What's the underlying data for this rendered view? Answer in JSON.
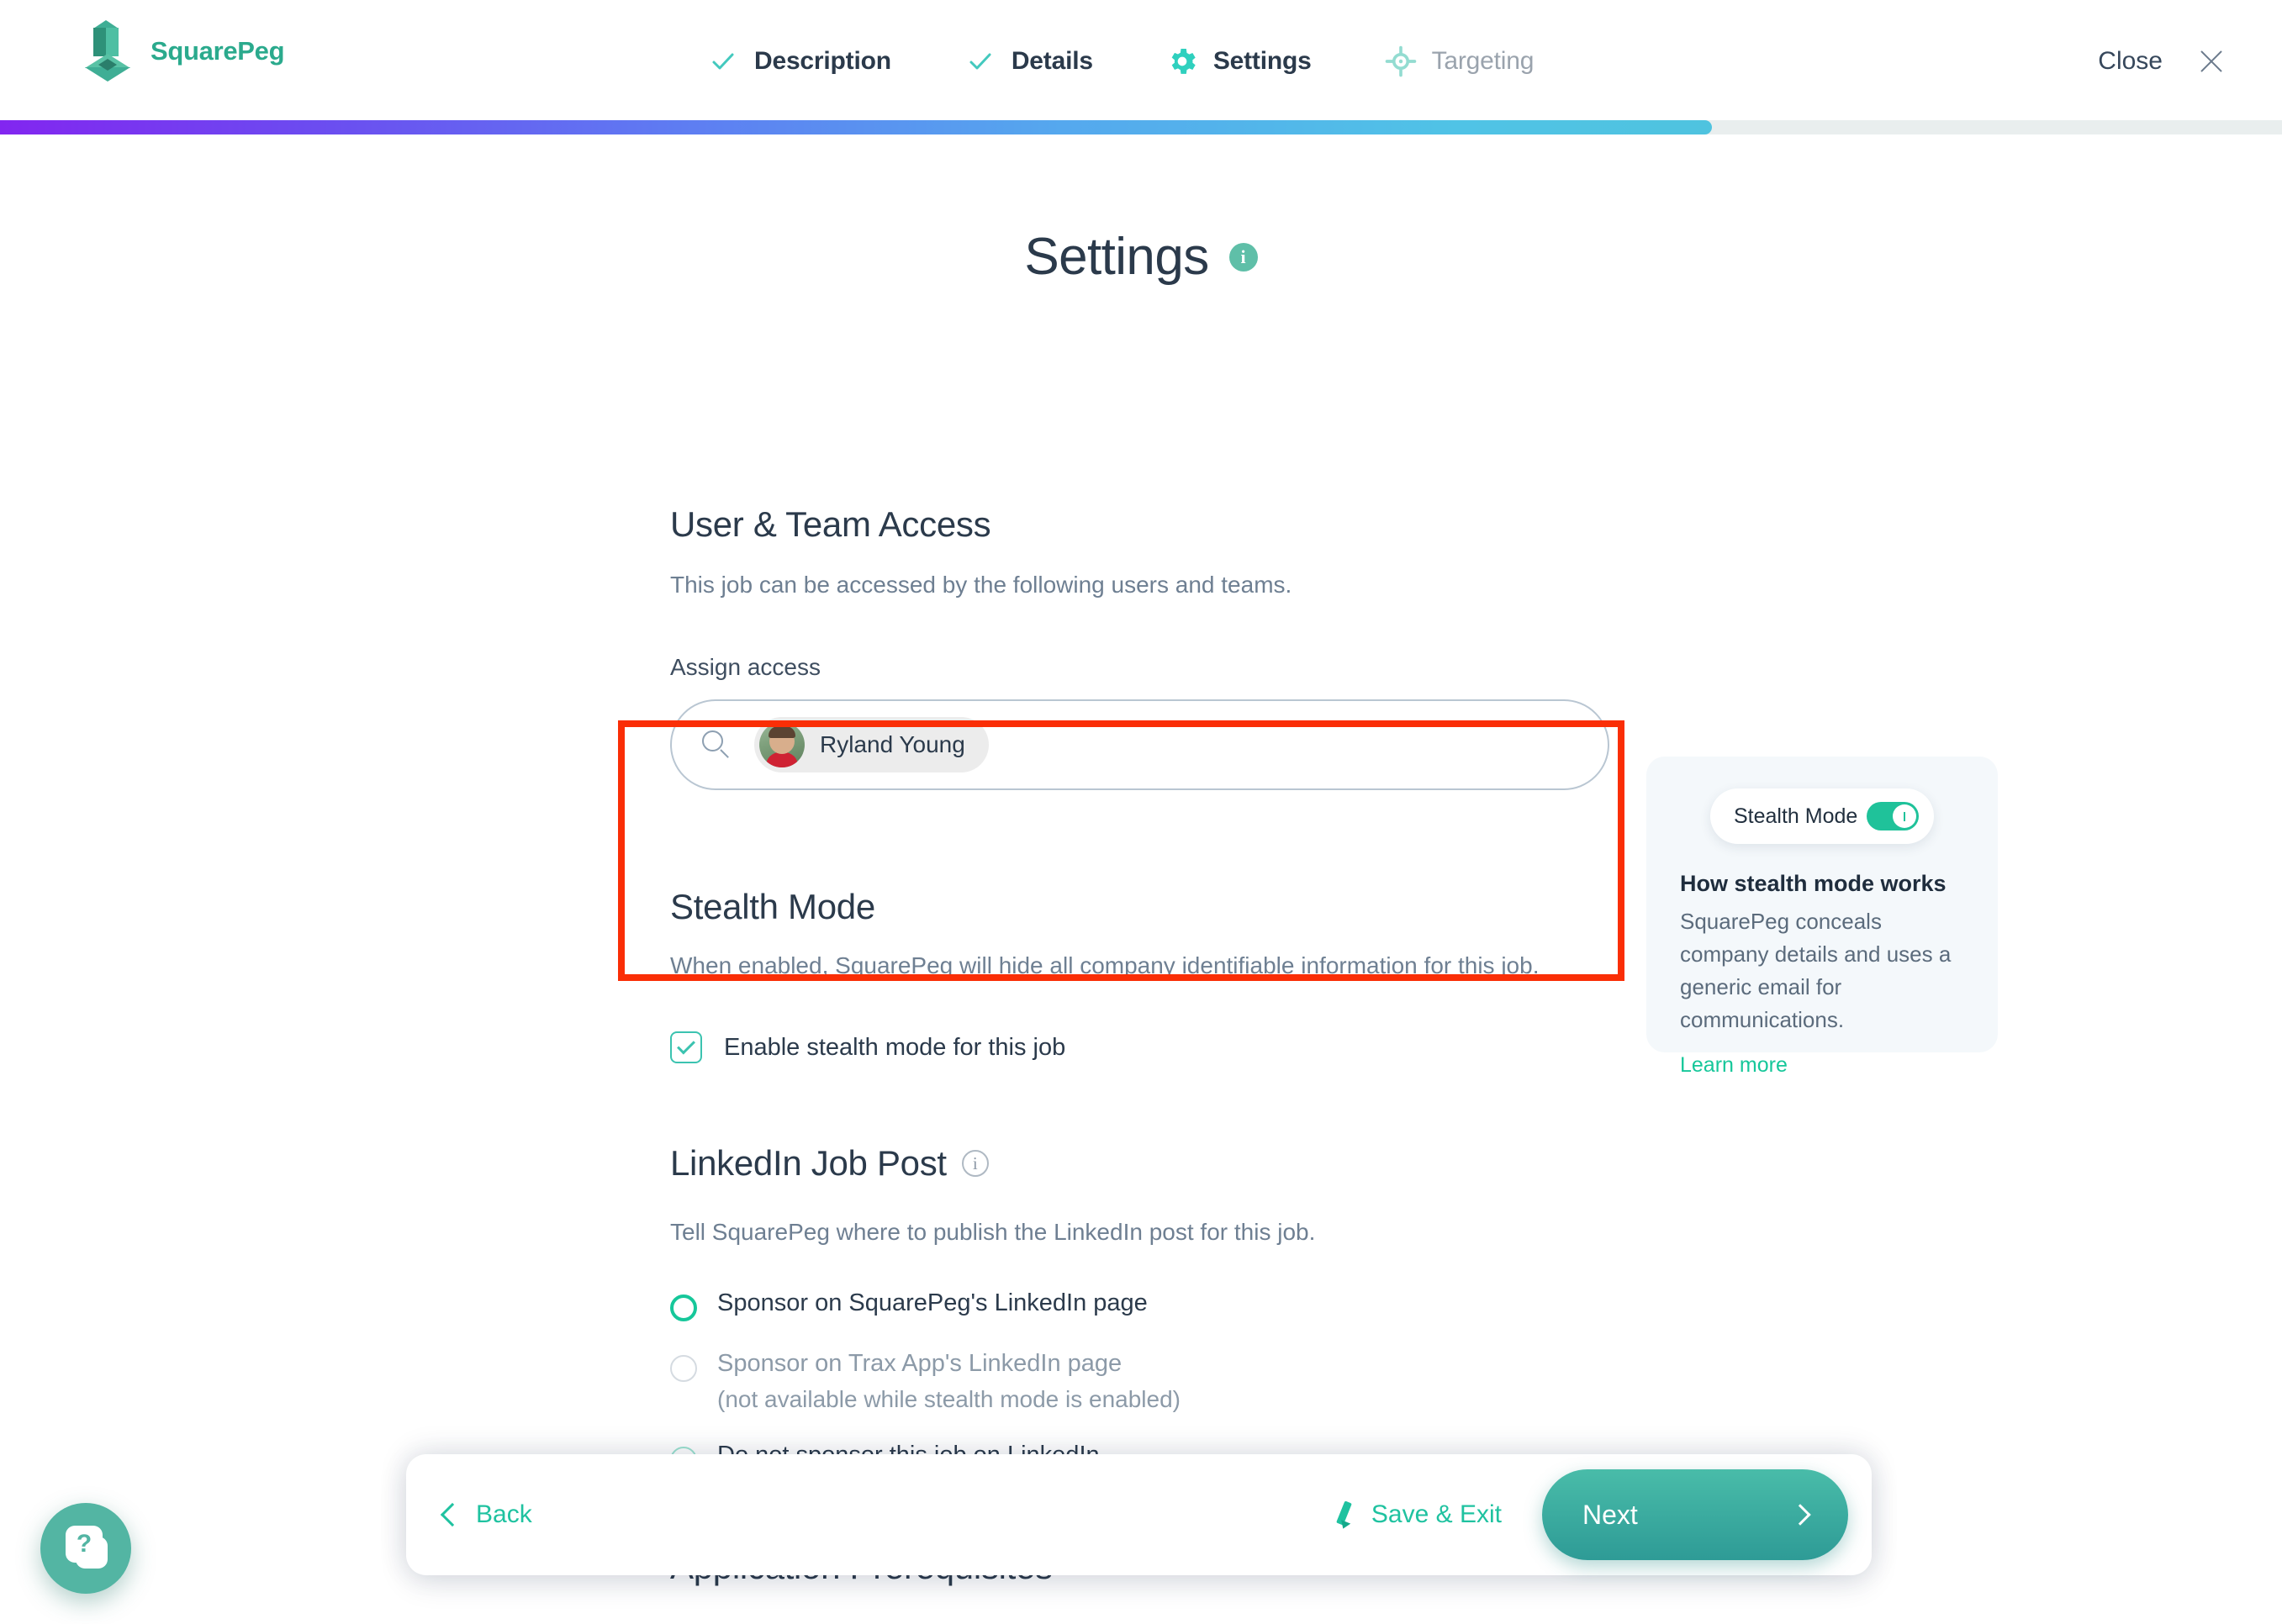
{
  "header": {
    "brand_name": "SquarePeg",
    "tabs": [
      {
        "label": "Description",
        "icon": "check-icon",
        "state": "complete"
      },
      {
        "label": "Details",
        "icon": "check-icon",
        "state": "complete"
      },
      {
        "label": "Settings",
        "icon": "gear-icon",
        "state": "active"
      },
      {
        "label": "Targeting",
        "icon": "crosshair-icon",
        "state": "upcoming"
      }
    ],
    "close_label": "Close",
    "close_icon": "close-x-icon",
    "progress_percent": 75
  },
  "page": {
    "title": "Settings",
    "title_info_icon": "info-icon"
  },
  "user_access": {
    "heading": "User & Team Access",
    "description": "This job can be accessed by the following users and teams.",
    "field_label": "Assign access",
    "search_icon": "search-icon",
    "search_placeholder": "",
    "chips": [
      {
        "name": "Ryland Young",
        "avatar": "user-avatar"
      }
    ]
  },
  "stealth": {
    "heading": "Stealth Mode",
    "description": "When enabled, SquarePeg will hide all company identifiable information for this job.",
    "checkbox_label": "Enable stealth mode for this job",
    "checkbox_checked": true,
    "highlight_color": "#FA2E06"
  },
  "tooltip_card": {
    "toggle_label": "Stealth Mode",
    "toggle_on": true,
    "heading": "How stealth mode works",
    "body": "SquarePeg conceals company details and uses a generic email for communications.",
    "link_label": "Learn more",
    "link_color": "#16C79A",
    "background": "#F4F8FB"
  },
  "linkedin": {
    "heading": "LinkedIn Job Post",
    "heading_info_icon": "info-icon",
    "description": "Tell SquarePeg where to publish the LinkedIn post for this job.",
    "options": [
      {
        "label": "Sponsor on SquarePeg's LinkedIn page",
        "selected": true,
        "disabled": false,
        "sub": ""
      },
      {
        "label": "Sponsor on Trax App's LinkedIn page",
        "selected": false,
        "disabled": true,
        "sub": "(not available while stealth mode is enabled)"
      },
      {
        "label": "Do not sponsor this job on LinkedIn",
        "selected": false,
        "disabled": false,
        "sub": ""
      }
    ]
  },
  "prerequisites": {
    "heading": "Application Prerequisites"
  },
  "bottom_bar": {
    "back_label": "Back",
    "back_icon": "chevron-left-icon",
    "save_exit_label": "Save & Exit",
    "save_exit_icon": "pencil-icon",
    "next_label": "Next",
    "next_icon": "chevron-right-icon"
  },
  "help": {
    "icon": "help-question-icon",
    "color": "#53B5A3"
  }
}
